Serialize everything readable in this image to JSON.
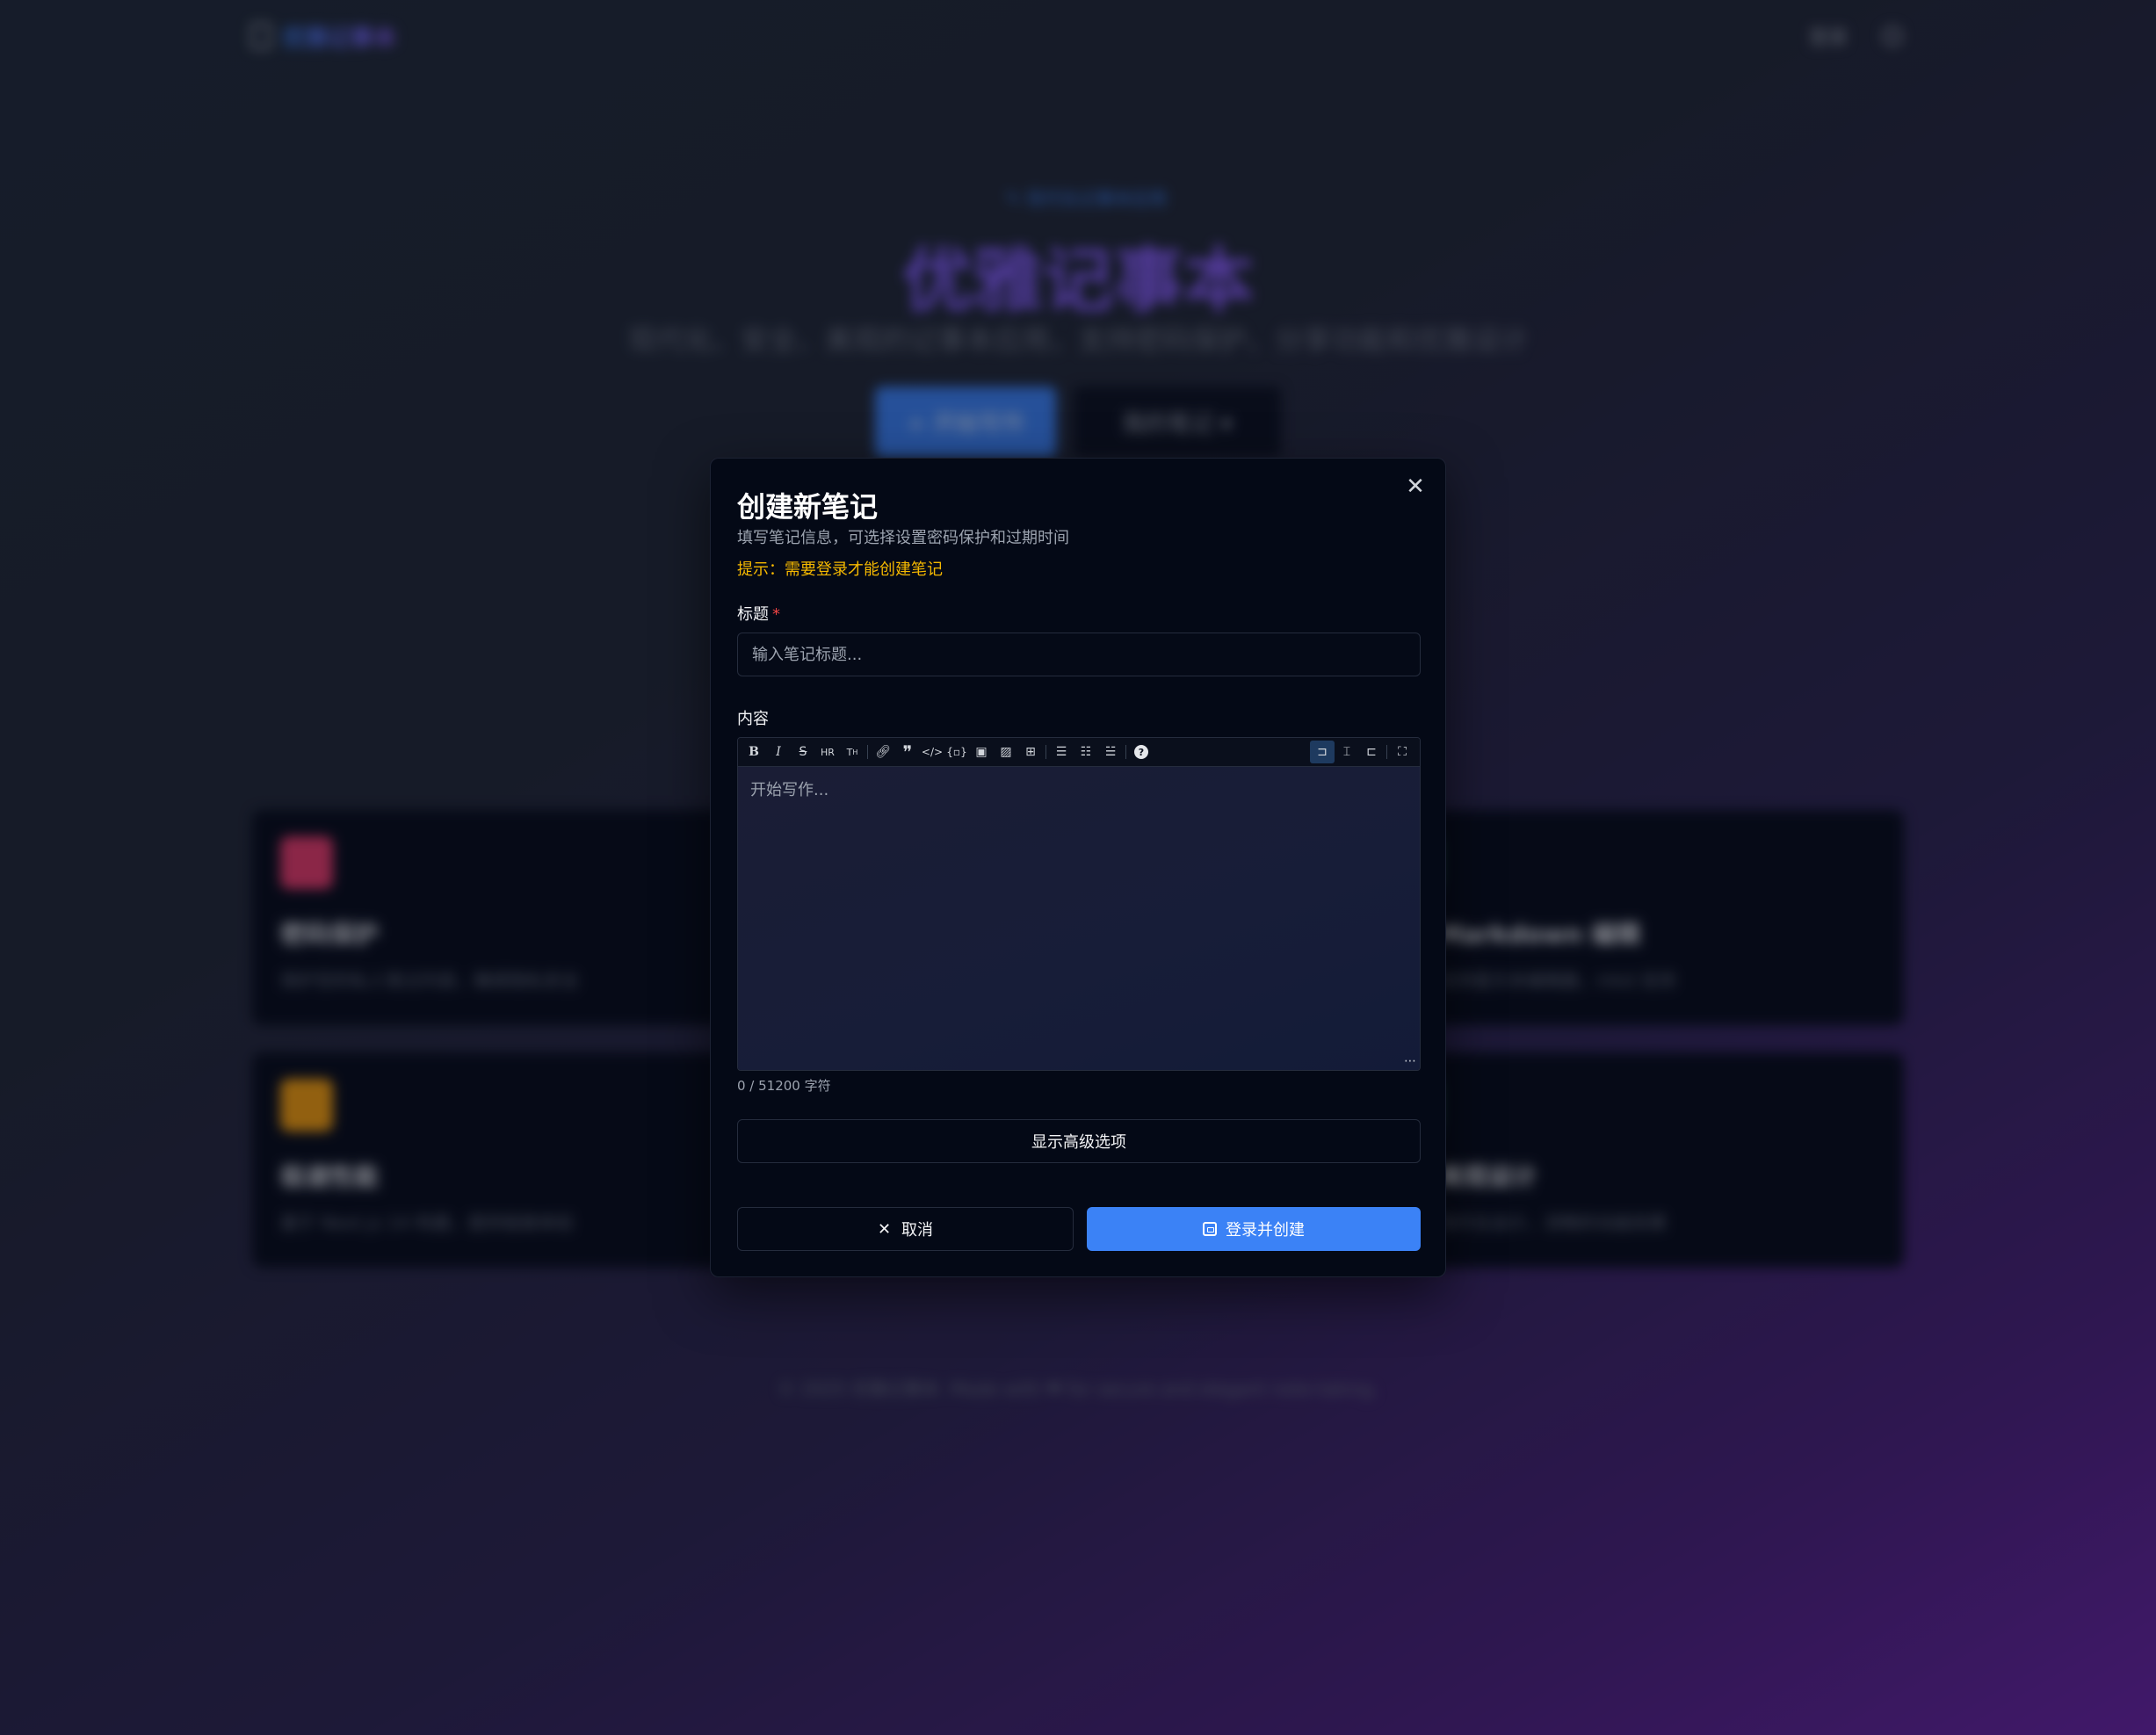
{
  "background": {
    "brand_name": "优雅记事本",
    "login_link": "登录",
    "hero_badge": "✎ 现代化记事本应用",
    "hero_title": "优雅记事本",
    "hero_subtitle": "现代化、安全、美观的记事本应用，支持密码保护、分享功能和优雅设计",
    "create_button": "+ 开始写作",
    "my_notes_button": "我的笔记 ▾",
    "features": [
      {
        "title": "密码保护",
        "desc": "保护您的私人笔记内容，确保隐私安全",
        "color": "#e8396a"
      },
      {
        "title": "Markdown 编辑",
        "desc": "支持富文本编辑器，mkd 支持",
        "color": "#10b981"
      },
      {
        "title": "极速性能",
        "desc": "基于 Next.js 14 构建，提供极致体验",
        "color": "#f59e0b"
      },
      {
        "title": "美观设计",
        "desc": "现代化设计，流畅的动画效果",
        "color": "#10b981"
      }
    ],
    "footer": "© 2025 优雅记事本. Made with ❤ for secure and elegant note-taking."
  },
  "modal": {
    "title": "创建新笔记",
    "description": "填写笔记信息，可选择设置密码保护和过期时间",
    "hint": "提示：需要登录才能创建笔记",
    "close_icon": "close-icon",
    "title_field": {
      "label": "标题",
      "required_mark": "*",
      "placeholder": "输入笔记标题...",
      "value": ""
    },
    "content_field": {
      "label": "内容",
      "placeholder": "开始写作...",
      "value": ""
    },
    "toolbar": {
      "left": [
        "bold-icon",
        "italic-icon",
        "strikethrough-icon",
        "hr-icon",
        "heading-icon",
        "link-icon",
        "quote-icon",
        "code-icon",
        "code-block-icon",
        "comment-icon",
        "image-icon",
        "table-icon",
        "unordered-list-icon",
        "ordered-list-icon",
        "checked-list-icon",
        "help-icon"
      ],
      "right": [
        "edit-mode-icon",
        "live-mode-icon",
        "preview-mode-icon",
        "fullscreen-icon"
      ],
      "active": "edit-mode-icon"
    },
    "char_count": "0 / 51200 字符",
    "advanced_button": "显示高级选项",
    "cancel_button": "取消",
    "submit_button": "登录并创建",
    "accent_color": "#3b82f6",
    "hint_color": "#f5b800"
  }
}
